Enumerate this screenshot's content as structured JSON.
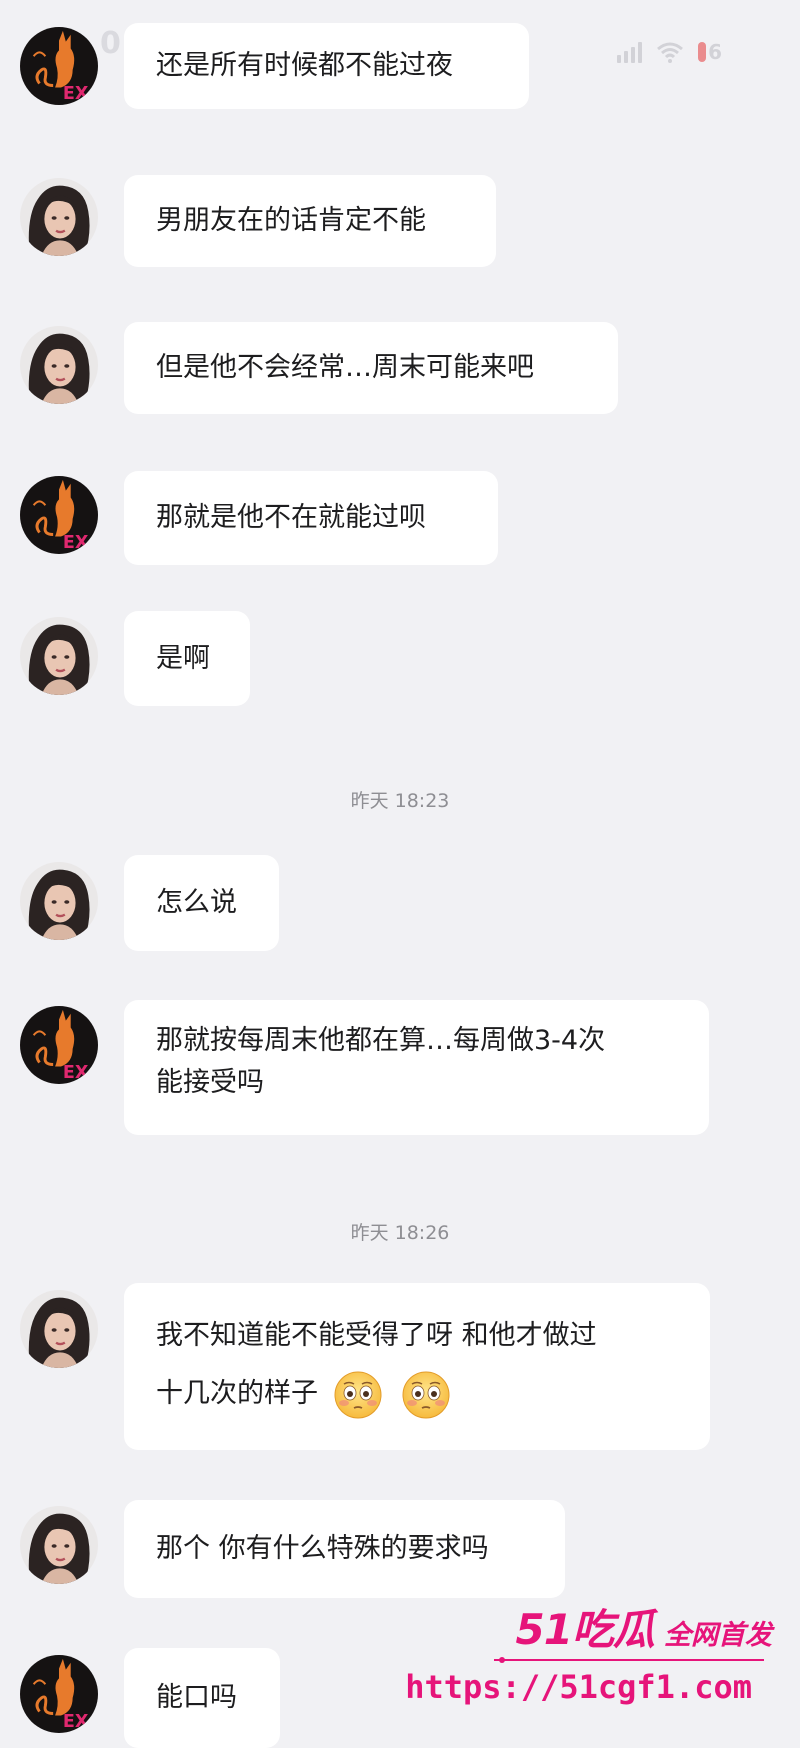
{
  "status_bar": {
    "battery_level": "6",
    "corner_digit": "0"
  },
  "messages": [
    {
      "sender": "cat",
      "text": "还是所有时候都不能过夜"
    },
    {
      "sender": "girl",
      "text": "男朋友在的话肯定不能"
    },
    {
      "sender": "girl",
      "text": "但是他不会经常…周末可能来吧"
    },
    {
      "sender": "cat",
      "text": "那就是他不在就能过呗"
    },
    {
      "sender": "girl",
      "text": "是啊"
    },
    {
      "timestamp": "昨天 18:23"
    },
    {
      "sender": "girl",
      "text": "怎么说"
    },
    {
      "sender": "cat",
      "line1": "那就按每周末他都在算…每周做3-4次",
      "line2": "能接受吗"
    },
    {
      "timestamp": "昨天 18:26"
    },
    {
      "sender": "girl",
      "line1": "我不知道能不能受得了呀 和他才做过",
      "line2": "十几次的样子",
      "emojis": [
        "flushed-face-icon",
        "flushed-face-icon"
      ]
    },
    {
      "sender": "girl",
      "text": "那个 你有什么特殊的要求吗"
    },
    {
      "sender": "cat",
      "text": "能口吗"
    }
  ],
  "avatar_badge_text": "EX",
  "watermark": {
    "brand": "51吃瓜",
    "slogan": "全网首发",
    "url": "https://51cgf1.com"
  },
  "colors": {
    "background": "#f1f1f4",
    "bubble": "#ffffff",
    "text": "#1d1d1f",
    "timestamp": "#8e8e93",
    "watermark": "#e6147a",
    "cat_avatar_bg": "#151212",
    "cat_avatar_orange": "#e77a2c"
  }
}
